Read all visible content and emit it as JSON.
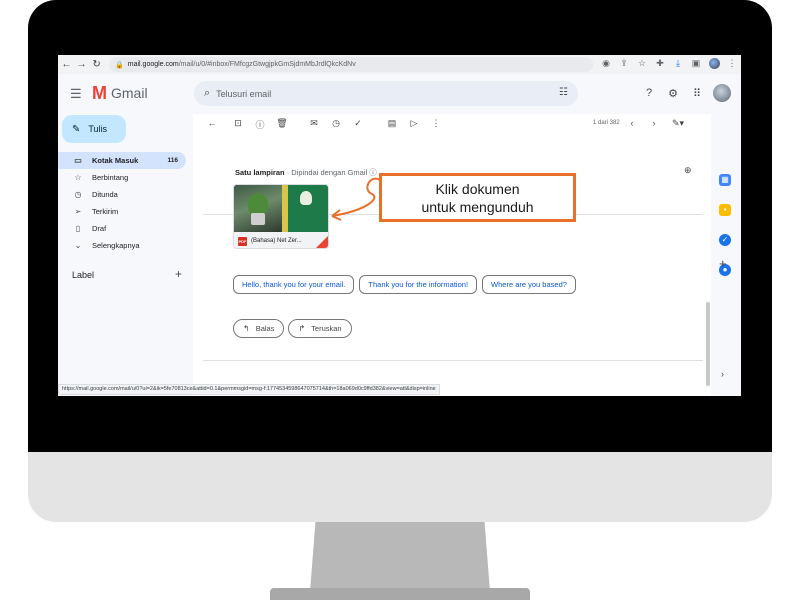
{
  "browser": {
    "url_host": "mail.google.com",
    "url_path": "/mail/u/0/#inbox/FMfcgzGtwgjpkGmSjdmMbJrdlQkcKdNv",
    "status_url": "https://mail.google.com/mail/u/0?ui=2&ik=5fe70813ce&attid=0.1&permmsgid=msg-f:1774534598647075714&th=18a069d0c9ffd382&view=att&disp=inline"
  },
  "gmail": {
    "logo_text": "Gmail",
    "search_placeholder": "Telusuri email"
  },
  "sidebar": {
    "compose_label": "Tulis",
    "items": [
      {
        "label": "Kotak Masuk",
        "count": "116",
        "icon": "inbox-icon"
      },
      {
        "label": "Berbintang",
        "icon": "star-icon"
      },
      {
        "label": "Ditunda",
        "icon": "clock-icon"
      },
      {
        "label": "Terkirim",
        "icon": "send-icon"
      },
      {
        "label": "Draf",
        "icon": "draft-icon"
      },
      {
        "label": "Selengkapnya",
        "icon": "chevron-down-icon"
      }
    ],
    "labels_heading": "Label"
  },
  "message": {
    "pager": "1 dari 382",
    "attachment_title": "Satu lampiran",
    "attachment_subtitle": "Dipindai dengan Gmail",
    "attachment_filename": "(Bahasa) Net Zer..."
  },
  "callout": {
    "line1": "Klik dokumen",
    "line2": "untuk mengunduh",
    "color": "#e8702a"
  },
  "smart_replies": [
    "Hello, thank you for your email.",
    "Thank you for the information!",
    "Where are you based?"
  ],
  "actions": {
    "reply": "Balas",
    "forward": "Teruskan"
  }
}
